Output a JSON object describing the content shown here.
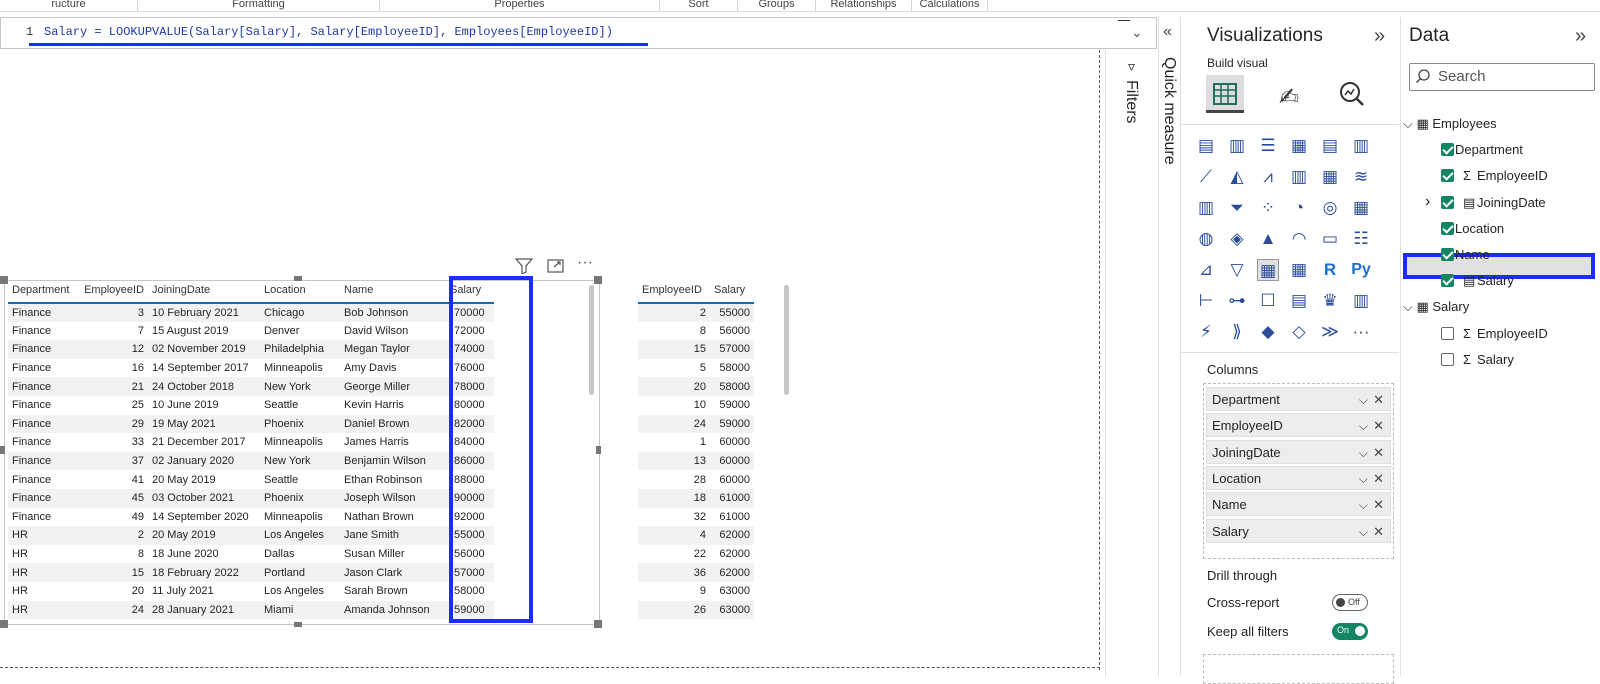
{
  "ribbon": {
    "groups": [
      "ructure",
      "Formatting",
      "Properties",
      "Sort",
      "Groups",
      "Relationships",
      "Calculations"
    ]
  },
  "formula": {
    "line_number": "1",
    "expression": "Salary = LOOKUPVALUE(Salary[Salary], Salary[EmployeeID], Employees[EmployeeID])"
  },
  "table1": {
    "columns": [
      "Department",
      "EmployeeID",
      "JoiningDate",
      "Location",
      "Name",
      "Salary"
    ],
    "rows": [
      [
        "Finance",
        "3",
        "10 February 2021",
        "Chicago",
        "Bob Johnson",
        "70000"
      ],
      [
        "Finance",
        "7",
        "15 August 2019",
        "Denver",
        "David Wilson",
        "72000"
      ],
      [
        "Finance",
        "12",
        "02 November 2019",
        "Philadelphia",
        "Megan Taylor",
        "74000"
      ],
      [
        "Finance",
        "16",
        "14 September 2017",
        "Minneapolis",
        "Amy Davis",
        "76000"
      ],
      [
        "Finance",
        "21",
        "24 October 2018",
        "New York",
        "George Miller",
        "78000"
      ],
      [
        "Finance",
        "25",
        "10 June 2019",
        "Seattle",
        "Kevin Harris",
        "80000"
      ],
      [
        "Finance",
        "29",
        "19 May 2021",
        "Phoenix",
        "Daniel Brown",
        "82000"
      ],
      [
        "Finance",
        "33",
        "21 December 2017",
        "Minneapolis",
        "James Harris",
        "84000"
      ],
      [
        "Finance",
        "37",
        "02 January 2020",
        "New York",
        "Benjamin Wilson",
        "86000"
      ],
      [
        "Finance",
        "41",
        "20 May 2019",
        "Seattle",
        "Ethan Robinson",
        "88000"
      ],
      [
        "Finance",
        "45",
        "03 October 2021",
        "Phoenix",
        "Joseph Wilson",
        "90000"
      ],
      [
        "Finance",
        "49",
        "14 September 2020",
        "Minneapolis",
        "Nathan Brown",
        "92000"
      ],
      [
        "HR",
        "2",
        "20 May 2019",
        "Los Angeles",
        "Jane Smith",
        "55000"
      ],
      [
        "HR",
        "8",
        "18 June 2020",
        "Dallas",
        "Susan Miller",
        "56000"
      ],
      [
        "HR",
        "15",
        "18 February 2022",
        "Portland",
        "Jason Clark",
        "57000"
      ],
      [
        "HR",
        "20",
        "11 July 2021",
        "Los Angeles",
        "Sarah Brown",
        "58000"
      ],
      [
        "HR",
        "24",
        "28 January 2021",
        "Miami",
        "Amanda Johnson",
        "59000"
      ]
    ]
  },
  "table2": {
    "columns": [
      "EmployeeID",
      "Salary"
    ],
    "rows": [
      [
        "2",
        "55000"
      ],
      [
        "8",
        "56000"
      ],
      [
        "15",
        "57000"
      ],
      [
        "5",
        "58000"
      ],
      [
        "20",
        "58000"
      ],
      [
        "10",
        "59000"
      ],
      [
        "24",
        "59000"
      ],
      [
        "1",
        "60000"
      ],
      [
        "13",
        "60000"
      ],
      [
        "28",
        "60000"
      ],
      [
        "18",
        "61000"
      ],
      [
        "32",
        "61000"
      ],
      [
        "4",
        "62000"
      ],
      [
        "22",
        "62000"
      ],
      [
        "36",
        "62000"
      ],
      [
        "9",
        "63000"
      ],
      [
        "26",
        "63000"
      ]
    ]
  },
  "filters_label": "Filters",
  "quick_measure_label": "Quick measure",
  "viz": {
    "title": "Visualizations",
    "build_visual": "Build visual",
    "columns_label": "Columns",
    "wells": [
      "Department",
      "EmployeeID",
      "JoiningDate",
      "Location",
      "Name",
      "Salary"
    ],
    "drill_through": "Drill through",
    "cross_report": "Cross-report",
    "cross_report_state": "Off",
    "keep_all_filters": "Keep all filters",
    "keep_all_filters_state": "On",
    "r_label": "R",
    "py_label": "Py",
    "more": "···"
  },
  "data": {
    "title": "Data",
    "search_placeholder": "Search",
    "tables": [
      {
        "name": "Employees",
        "fields": [
          {
            "name": "Department",
            "checked": true,
            "sigma": false
          },
          {
            "name": "EmployeeID",
            "checked": true,
            "sigma": true
          },
          {
            "name": "JoiningDate",
            "checked": true,
            "sigma": false
          },
          {
            "name": "Location",
            "checked": true,
            "sigma": false
          },
          {
            "name": "Name",
            "checked": true,
            "sigma": false
          },
          {
            "name": "Salary",
            "checked": true,
            "sigma": false
          }
        ]
      },
      {
        "name": "Salary",
        "fields": [
          {
            "name": "EmployeeID",
            "checked": false,
            "sigma": true
          },
          {
            "name": "Salary",
            "checked": false,
            "sigma": true
          }
        ]
      }
    ]
  },
  "colors": {
    "accent": "#1a2cff",
    "check": "#128565",
    "underline": "#0f6cbd"
  }
}
